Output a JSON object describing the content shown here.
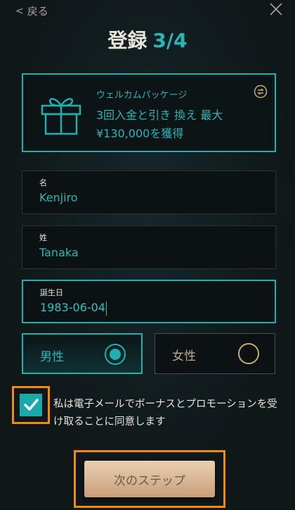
{
  "nav": {
    "back_label": "戻る"
  },
  "header": {
    "title": "登録",
    "step": "3/4"
  },
  "promo": {
    "small": "ウェルカムパッケージ",
    "line1": "3回入金と引き 換え 最大",
    "line2": "¥130,000を獲得"
  },
  "form": {
    "first_name": {
      "label": "名",
      "value": "Kenjiro"
    },
    "last_name": {
      "label": "姓",
      "value": "Tanaka"
    },
    "birthdate": {
      "label": "誕生日",
      "value": "1983-06-04"
    },
    "gender": {
      "male": "男性",
      "female": "女性",
      "selected": "male"
    }
  },
  "consent": {
    "text": "私は電子メールでボーナスとプロモーションを受け取ることに同意します",
    "checked": true
  },
  "next_button": {
    "label": "次のステップ"
  }
}
